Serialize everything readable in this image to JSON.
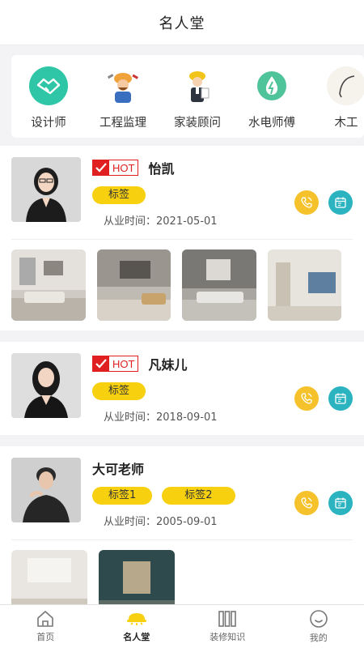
{
  "header": {
    "title": "名人堂"
  },
  "categories": [
    {
      "label": "设计师",
      "icon": "handshake-icon",
      "color": "#2ec6a6"
    },
    {
      "label": "工程监理",
      "icon": "engineer-icon"
    },
    {
      "label": "家装顾问",
      "icon": "advisor-icon"
    },
    {
      "label": "水电师傅",
      "icon": "water-electric-icon",
      "color": "#4fc39a"
    },
    {
      "label": "木工",
      "icon": "carpenter-icon"
    }
  ],
  "designers": [
    {
      "hot_label": "HOT",
      "name": "怡凯",
      "tags": [
        "标签"
      ],
      "since": "从业时间：2021-05-01"
    },
    {
      "hot_label": "HOT",
      "name": "凡妹儿",
      "tags": [
        "标签"
      ],
      "since": "从业时间：2018-09-01"
    },
    {
      "name": "大可老师",
      "tags": [
        "标签1",
        "标签2"
      ],
      "since": "从业时间：2005-09-01"
    }
  ],
  "tabbar": {
    "items": [
      {
        "label": "首页",
        "icon": "home-icon"
      },
      {
        "label": "名人堂",
        "icon": "hall-of-fame-icon",
        "active": true
      },
      {
        "label": "装修知识",
        "icon": "books-icon"
      },
      {
        "label": "我的",
        "icon": "smile-icon"
      }
    ]
  },
  "colors": {
    "accent": "#f7d10f",
    "hot": "#e02020",
    "phone": "#f5c22b",
    "chat": "#2bb3c0"
  }
}
